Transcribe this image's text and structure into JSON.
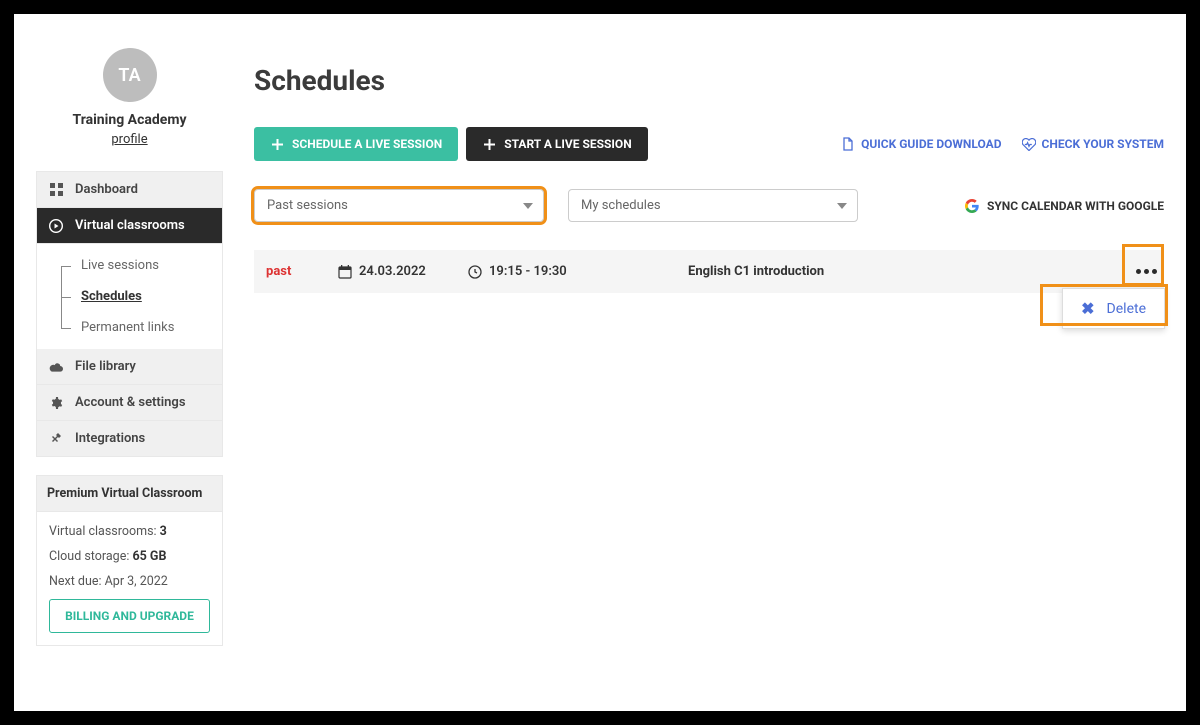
{
  "sidebar": {
    "avatar_initials": "TA",
    "org_name": "Training Academy",
    "profile_link": "profile",
    "nav": {
      "dashboard": "Dashboard",
      "virtual_classrooms": "Virtual classrooms",
      "live_sessions": "Live sessions",
      "schedules": "Schedules",
      "permanent_links": "Permanent links",
      "file_library": "File library",
      "account_settings": "Account & settings",
      "integrations": "Integrations"
    },
    "premium": {
      "heading": "Premium Virtual Classroom",
      "vc_label": "Virtual classrooms: ",
      "vc_value": "3",
      "storage_label": "Cloud storage: ",
      "storage_value": "65 GB",
      "next_due_label": "Next due: ",
      "next_due_value": "Apr 3, 2022",
      "billing_btn": "BILLING AND UPGRADE"
    }
  },
  "main": {
    "title": "Schedules",
    "buttons": {
      "schedule": "SCHEDULE A LIVE SESSION",
      "start": "START A LIVE SESSION"
    },
    "links": {
      "quick_guide": "QUICK GUIDE DOWNLOAD",
      "check_system": "CHECK YOUR SYSTEM",
      "sync_google": "SYNC CALENDAR WITH GOOGLE"
    },
    "filters": {
      "sessions": "Past sessions",
      "schedules": "My schedules"
    },
    "row": {
      "status": "past",
      "date": "24.03.2022",
      "time": "19:15 - 19:30",
      "title": "English C1 introduction"
    },
    "dropdown": {
      "delete": "Delete"
    }
  }
}
